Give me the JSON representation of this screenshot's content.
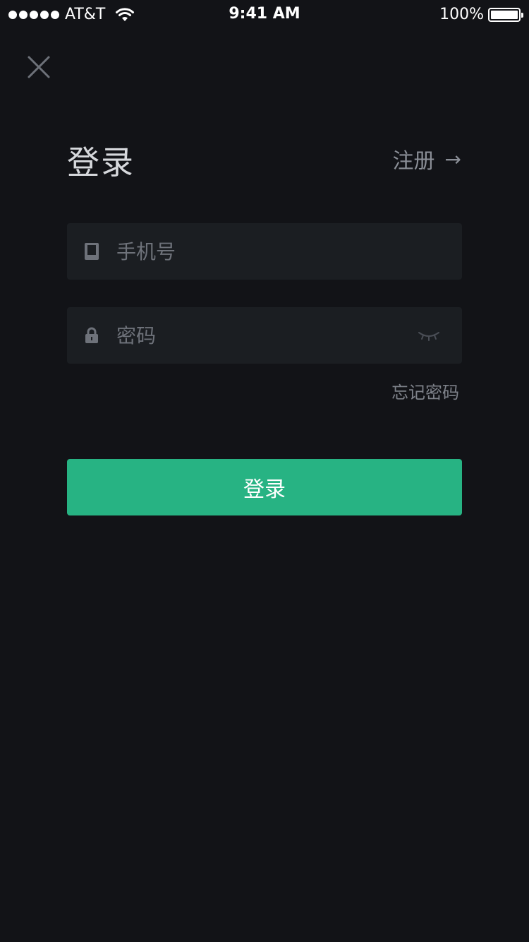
{
  "status_bar": {
    "carrier": "AT&T",
    "time": "9:41 AM",
    "battery": "100%"
  },
  "header": {
    "title": "登录",
    "register_label": "注册",
    "register_arrow": "→"
  },
  "form": {
    "phone_placeholder": "手机号",
    "phone_value": "",
    "password_placeholder": "密码",
    "password_value": "",
    "forgot_label": "忘记密码",
    "submit_label": "登录"
  },
  "colors": {
    "background": "#121317",
    "field_background": "#1b1e22",
    "accent": "#27b383",
    "muted_text": "#8a8e96"
  },
  "icons": {
    "close": "close-icon",
    "phone": "phone-icon",
    "lock": "lock-icon",
    "eye": "eye-closed-icon",
    "arrow": "arrow-right-icon"
  }
}
